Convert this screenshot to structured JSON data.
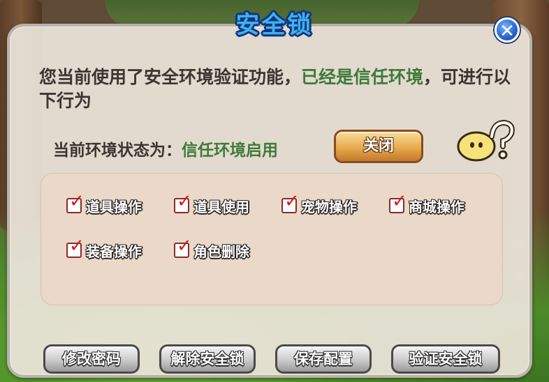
{
  "colors": {
    "title": "#3fb1f0",
    "highlight_green": "#3f7a3a",
    "checkbox_tick": "#d11f1f",
    "toggle_button": "#e7aa4e",
    "panel_bg": "#ece4da"
  },
  "dialog": {
    "title": "安全锁",
    "close_icon": "close-icon"
  },
  "description": {
    "prefix": "您当前使用了安全环境验证功能，",
    "highlight": "已经是信任环境",
    "suffix": "，可进行以下行为"
  },
  "status": {
    "label": "当前环境状态为：",
    "value": "信任环境启用",
    "toggle_label": "关闭",
    "help_icon": "help-mascot-icon"
  },
  "permissions": [
    {
      "label": "道具操作",
      "checked": true
    },
    {
      "label": "道具使用",
      "checked": true
    },
    {
      "label": "宠物操作",
      "checked": true
    },
    {
      "label": "商城操作",
      "checked": true
    },
    {
      "label": "装备操作",
      "checked": true
    },
    {
      "label": "角色删除",
      "checked": true
    }
  ],
  "buttons": {
    "change_password": "修改密码",
    "remove_lock": "解除安全锁",
    "save_config": "保存配置",
    "verify_lock": "验证安全锁"
  }
}
